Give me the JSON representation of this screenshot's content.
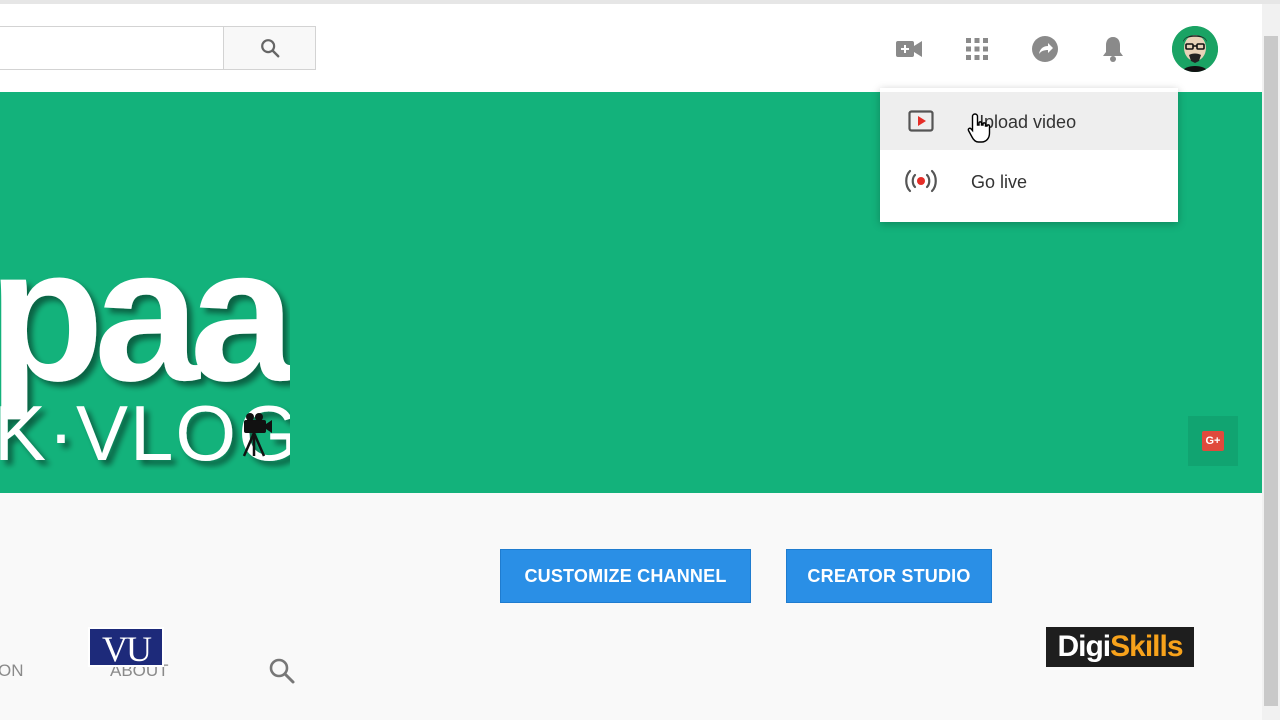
{
  "header": {
    "search_placeholder": "",
    "icons": [
      "video-camera-plus-icon",
      "apps-grid-icon",
      "share-arrow-icon",
      "notifications-bell-icon"
    ]
  },
  "banner": {
    "logo_main": "paab",
    "logo_sub": "K·VLOG",
    "background_color": "#13b27b",
    "social_link": "G+"
  },
  "dropdown": {
    "items": [
      {
        "label": "Upload video",
        "icon": "upload-video-icon"
      },
      {
        "label": "Go live",
        "icon": "live-broadcast-icon"
      }
    ]
  },
  "buttons": {
    "customize": "CUSTOMIZE CHANNEL",
    "creator_studio": "CREATOR STUDIO"
  },
  "tabs": {
    "partial": "ON",
    "about": "ABOUT"
  },
  "watermarks": {
    "vu": "VU",
    "digi_part1": "Digi",
    "digi_part2": "Skills"
  },
  "colors": {
    "accent_button": "#2a8fe6",
    "banner": "#13b27b"
  }
}
